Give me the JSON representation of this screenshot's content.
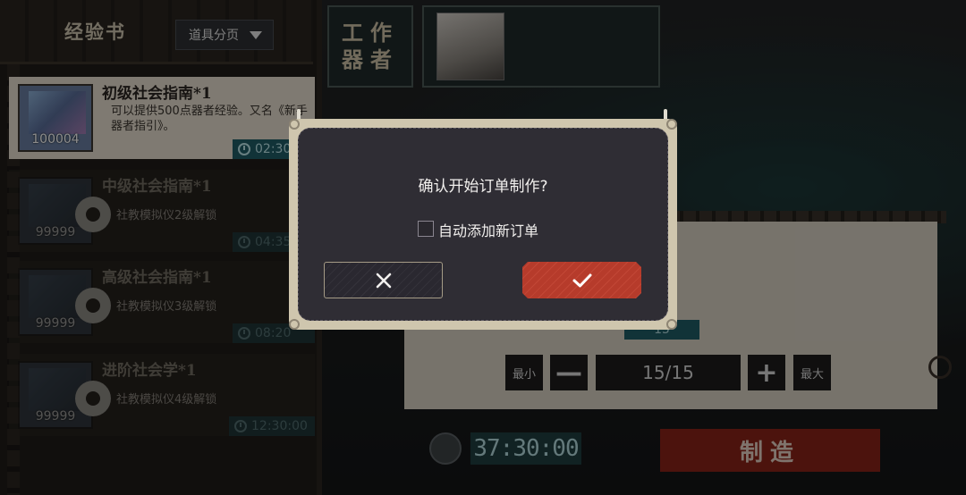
{
  "left": {
    "title": "经验书",
    "filter_label": "道具分页",
    "items": [
      {
        "name": "初级社会指南*1",
        "desc": "可以提供500点器者经验。又名《新手器者指引》。",
        "count": "100004",
        "time": "02:30",
        "locked": false
      },
      {
        "name": "中级社会指南*1",
        "lock_text": "社教模拟仪2级解锁",
        "count": "99999",
        "time": "04:35",
        "locked": true
      },
      {
        "name": "高级社会指南*1",
        "lock_text": "社教模拟仪3级解锁",
        "count": "99999",
        "time": "08:20",
        "locked": true
      },
      {
        "name": "进阶社会学*1",
        "lock_text": "社教模拟仪4级解锁",
        "count": "99999",
        "time": "12:30:00",
        "locked": true
      }
    ]
  },
  "worker": {
    "label_line1": "工作",
    "label_line2": "器者"
  },
  "production": {
    "qty_badge": "15",
    "min_label": "最小",
    "max_label": "最大",
    "minus_label": "—",
    "plus_label": "+",
    "quantity": "15/15",
    "timer": "37:30:00",
    "make_label": "制造"
  },
  "dialog": {
    "message": "确认开始订单制作?",
    "auto_add_label": "自动添加新订单",
    "auto_add_checked": false
  }
}
